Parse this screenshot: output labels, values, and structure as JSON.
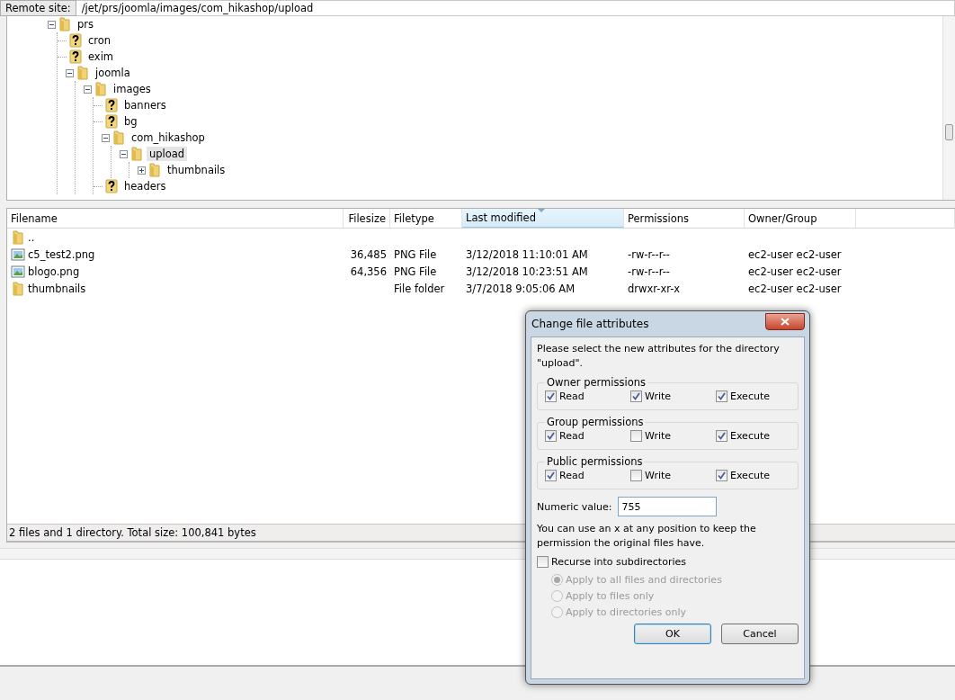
{
  "remote_site": {
    "label": "Remote site:",
    "path": "/jet/prs/joomla/images/com_hikashop/upload"
  },
  "tree": [
    {
      "label": "prs",
      "kind": "folder",
      "expanded": true,
      "selected": false,
      "children": [
        {
          "label": "cron",
          "kind": "unknown",
          "expanded": false,
          "selected": false
        },
        {
          "label": "exim",
          "kind": "unknown",
          "expanded": false,
          "selected": false
        },
        {
          "label": "joomla",
          "kind": "folder",
          "expanded": true,
          "selected": false,
          "children": [
            {
              "label": "images",
              "kind": "folder",
              "expanded": true,
              "selected": false,
              "children": [
                {
                  "label": "banners",
                  "kind": "unknown",
                  "expanded": false,
                  "selected": false
                },
                {
                  "label": "bg",
                  "kind": "unknown",
                  "expanded": false,
                  "selected": false
                },
                {
                  "label": "com_hikashop",
                  "kind": "folder",
                  "expanded": true,
                  "selected": false,
                  "children": [
                    {
                      "label": "upload",
                      "kind": "folder",
                      "expanded": true,
                      "selected": true,
                      "children": [
                        {
                          "label": "thumbnails",
                          "kind": "folder",
                          "expanded": false,
                          "selected": false
                        }
                      ]
                    }
                  ]
                },
                {
                  "label": "headers",
                  "kind": "unknown",
                  "expanded": false,
                  "selected": false
                }
              ]
            }
          ]
        }
      ]
    }
  ],
  "file_list": {
    "columns": [
      {
        "label": "Filename",
        "sorted": false
      },
      {
        "label": "Filesize",
        "sorted": false
      },
      {
        "label": "Filetype",
        "sorted": false
      },
      {
        "label": "Last modified",
        "sorted": true
      },
      {
        "label": "Permissions",
        "sorted": false
      },
      {
        "label": "Owner/Group",
        "sorted": false
      }
    ],
    "rows": [
      {
        "kind": "folder",
        "cells": [
          ".."
        ]
      },
      {
        "kind": "image",
        "cells": [
          "c5_test2.png",
          "36,485",
          "PNG File",
          "3/12/2018 11:10:01 AM",
          "-rw-r--r--",
          "ec2-user ec2-user"
        ]
      },
      {
        "kind": "image",
        "cells": [
          "blogo.png",
          "64,356",
          "PNG File",
          "3/12/2018 10:23:51 AM",
          "-rw-r--r--",
          "ec2-user ec2-user"
        ]
      },
      {
        "kind": "folder",
        "cells": [
          "thumbnails",
          "",
          "File folder",
          "3/7/2018 9:05:06 AM",
          "drwxr-xr-x",
          "ec2-user ec2-user"
        ]
      }
    ]
  },
  "status_bar": "2 files and 1 directory. Total size: 100,841 bytes",
  "dialog": {
    "title": "Change file attributes",
    "message": "Please select the new attributes for the directory \"upload\".",
    "groups": [
      {
        "title": "Owner permissions",
        "options": [
          {
            "label": "Read",
            "checked": true
          },
          {
            "label": "Write",
            "checked": true
          },
          {
            "label": "Execute",
            "checked": true
          }
        ]
      },
      {
        "title": "Group permissions",
        "options": [
          {
            "label": "Read",
            "checked": true
          },
          {
            "label": "Write",
            "checked": false
          },
          {
            "label": "Execute",
            "checked": true
          }
        ]
      },
      {
        "title": "Public permissions",
        "options": [
          {
            "label": "Read",
            "checked": true
          },
          {
            "label": "Write",
            "checked": false
          },
          {
            "label": "Execute",
            "checked": true
          }
        ]
      }
    ],
    "numeric_label": "Numeric value:",
    "numeric_value": "755",
    "hint": "You can use an x at any position to keep the permission the original files have.",
    "recurse": {
      "label": "Recurse into subdirectories",
      "checked": false
    },
    "apply_options": [
      {
        "label": "Apply to all files and directories",
        "selected": true,
        "disabled": true
      },
      {
        "label": "Apply to files only",
        "selected": false,
        "disabled": true
      },
      {
        "label": "Apply to directories only",
        "selected": false,
        "disabled": true
      }
    ],
    "buttons": [
      {
        "label": "OK",
        "default": true
      },
      {
        "label": "Cancel",
        "default": false
      }
    ]
  }
}
